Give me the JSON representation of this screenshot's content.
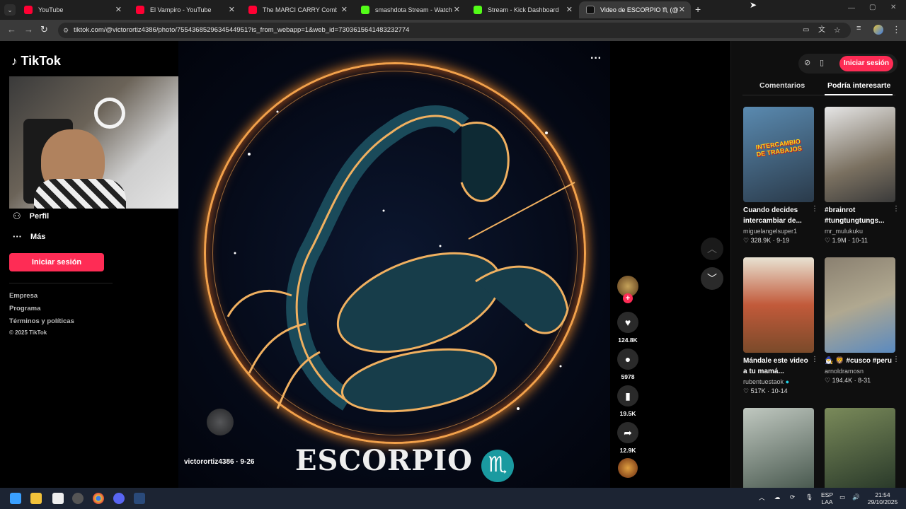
{
  "browser": {
    "tabs": [
      {
        "title": "YouTube",
        "color": "#ff0033"
      },
      {
        "title": "El Vampiro - YouTube",
        "color": "#ff0033"
      },
      {
        "title": "The MARCI CARRY Combo That",
        "color": "#ff0033"
      },
      {
        "title": "smashdota Stream - Watch Live",
        "color": "#53fc18"
      },
      {
        "title": "Stream - Kick Dashboard",
        "color": "#53fc18"
      },
      {
        "title": "Video de ESCORPIO ♏ (@victo",
        "color": "#111111"
      }
    ],
    "url": "tiktok.com/@victorortiz4386/photo/7554368529634544951?is_from_webapp=1&web_id=7303615641483232774"
  },
  "left": {
    "logo": "TikTok",
    "nav": [
      {
        "label": "Perfil",
        "icon": "person-icon"
      },
      {
        "label": "Más",
        "icon": "ellipsis-icon"
      }
    ],
    "login_label": "Iniciar sesión",
    "footer": [
      "Empresa",
      "Programa",
      "Términos y políticas",
      "© 2025 TikTok"
    ]
  },
  "video": {
    "title_text": "ESCORPIO",
    "sign": "♏",
    "author": "victorortiz4386 · 9-26",
    "likes": "124.8K",
    "comments": "5978",
    "saves": "19.5K",
    "shares": "12.9K",
    "colors": {
      "ring": "#f2a14b",
      "bg": "#050a18"
    }
  },
  "right": {
    "login_label": "Iniciar sesión",
    "tabs": [
      "Comentarios",
      "Podría interesarte"
    ],
    "cards": [
      {
        "title": "Cuando decides intercambiar de...",
        "user": "miguelangelsuper1",
        "likes": "328.9K",
        "date": "9-19",
        "thumb_text": "INTERCAMBIO DE TRABAJOS",
        "color": "#3a6a8a"
      },
      {
        "title": "#brainrot #tungtungtungs...",
        "user": "mr_mulukuku",
        "likes": "1.9M",
        "date": "10-11",
        "thumb_text": "",
        "color": "#8a8a80"
      },
      {
        "title": "Mándale este video a tu mamá...",
        "user": "rubentuestaok",
        "likes": "517K",
        "date": "10-14",
        "thumb_text": "",
        "color": "#c25a3a"
      },
      {
        "title": "🧙‍♂️ 🦁 #cusco #peru",
        "user": "arnoldramosn",
        "likes": "194.4K",
        "date": "8-31",
        "thumb_text": "",
        "color": "#9a8a70"
      },
      {
        "title": "",
        "user": "",
        "likes": "",
        "date": "",
        "thumb_text": "",
        "color": "#5a6a70"
      },
      {
        "title": "",
        "user": "",
        "likes": "",
        "date": "",
        "thumb_text": "",
        "color": "#6a7a5a"
      }
    ]
  },
  "taskbar": {
    "lang_top": "ESP",
    "lang_bottom": "LAA",
    "time": "21:54",
    "date": "29/10/2025"
  }
}
